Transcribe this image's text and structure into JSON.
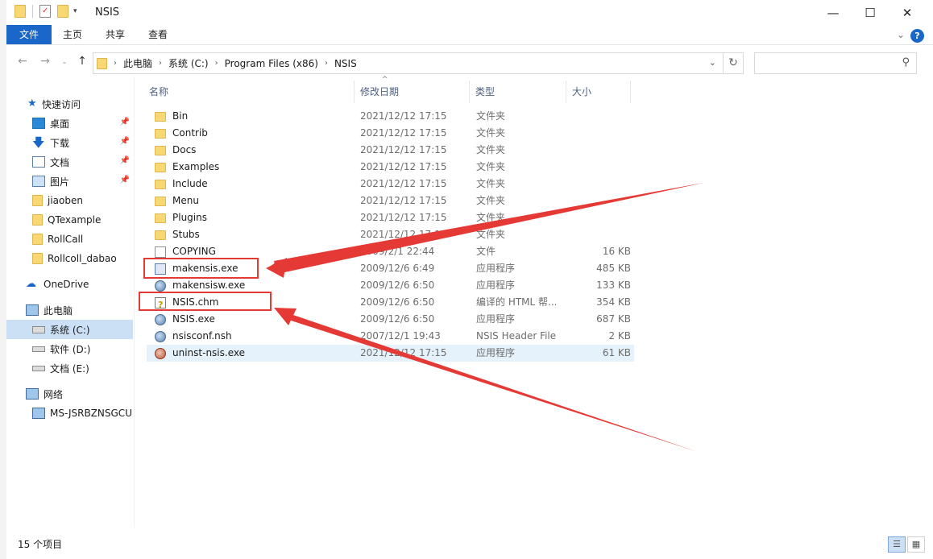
{
  "window": {
    "title": "NSIS"
  },
  "ribbon": {
    "tabs": [
      "文件",
      "主页",
      "共享",
      "查看"
    ]
  },
  "address": {
    "crumbs": [
      "此电脑",
      "系统 (C:)",
      "Program Files (x86)",
      "NSIS"
    ],
    "search_placeholder": ""
  },
  "nav": {
    "quick_access": "快速访问",
    "items": [
      {
        "label": "桌面",
        "icon": "desktop-icon",
        "pinned": true
      },
      {
        "label": "下载",
        "icon": "download-icon",
        "pinned": true
      },
      {
        "label": "文档",
        "icon": "documents-icon",
        "pinned": true
      },
      {
        "label": "图片",
        "icon": "pictures-icon",
        "pinned": true
      },
      {
        "label": "jiaoben",
        "icon": "folder-icon"
      },
      {
        "label": "QTexample",
        "icon": "folder-icon"
      },
      {
        "label": "RollCall",
        "icon": "folder-icon"
      },
      {
        "label": "Rollcoll_dabao",
        "icon": "folder-icon"
      }
    ],
    "onedrive": "OneDrive",
    "this_pc": "此电脑",
    "drives": [
      {
        "label": "系统 (C:)",
        "selected": true
      },
      {
        "label": "软件 (D:)"
      },
      {
        "label": "文档 (E:)"
      }
    ],
    "network": "网络",
    "computer": "MS-JSRBZNSGCU"
  },
  "columns": {
    "name": "名称",
    "date": "修改日期",
    "type": "类型",
    "size": "大小"
  },
  "files": [
    {
      "name": "Bin",
      "date": "2021/12/12 17:15",
      "type": "文件夹",
      "size": "",
      "icon": "folder"
    },
    {
      "name": "Contrib",
      "date": "2021/12/12 17:15",
      "type": "文件夹",
      "size": "",
      "icon": "folder"
    },
    {
      "name": "Docs",
      "date": "2021/12/12 17:15",
      "type": "文件夹",
      "size": "",
      "icon": "folder"
    },
    {
      "name": "Examples",
      "date": "2021/12/12 17:15",
      "type": "文件夹",
      "size": "",
      "icon": "folder"
    },
    {
      "name": "Include",
      "date": "2021/12/12 17:15",
      "type": "文件夹",
      "size": "",
      "icon": "folder"
    },
    {
      "name": "Menu",
      "date": "2021/12/12 17:15",
      "type": "文件夹",
      "size": "",
      "icon": "folder"
    },
    {
      "name": "Plugins",
      "date": "2021/12/12 17:15",
      "type": "文件夹",
      "size": "",
      "icon": "folder"
    },
    {
      "name": "Stubs",
      "date": "2021/12/12 17:15",
      "type": "文件夹",
      "size": "",
      "icon": "folder"
    },
    {
      "name": "COPYING",
      "date": "2009/2/1 22:44",
      "type": "文件",
      "size": "16 KB",
      "icon": "doc"
    },
    {
      "name": "makensis.exe",
      "date": "2009/12/6 6:49",
      "type": "应用程序",
      "size": "485 KB",
      "icon": "exe"
    },
    {
      "name": "makensisw.exe",
      "date": "2009/12/6 6:50",
      "type": "应用程序",
      "size": "133 KB",
      "icon": "round"
    },
    {
      "name": "NSIS.chm",
      "date": "2009/12/6 6:50",
      "type": "编译的 HTML 帮...",
      "size": "354 KB",
      "icon": "chm"
    },
    {
      "name": "NSIS.exe",
      "date": "2009/12/6 6:50",
      "type": "应用程序",
      "size": "687 KB",
      "icon": "round"
    },
    {
      "name": "nsisconf.nsh",
      "date": "2007/12/1 19:43",
      "type": "NSIS Header File",
      "size": "2 KB",
      "icon": "round"
    },
    {
      "name": "uninst-nsis.exe",
      "date": "2021/12/12 17:15",
      "type": "应用程序",
      "size": "61 KB",
      "icon": "red-round"
    }
  ],
  "status": {
    "count": "15 个项目"
  },
  "colors": {
    "accent": "#1a67c9",
    "annotation": "#e53935",
    "selection": "#cce0f5"
  }
}
